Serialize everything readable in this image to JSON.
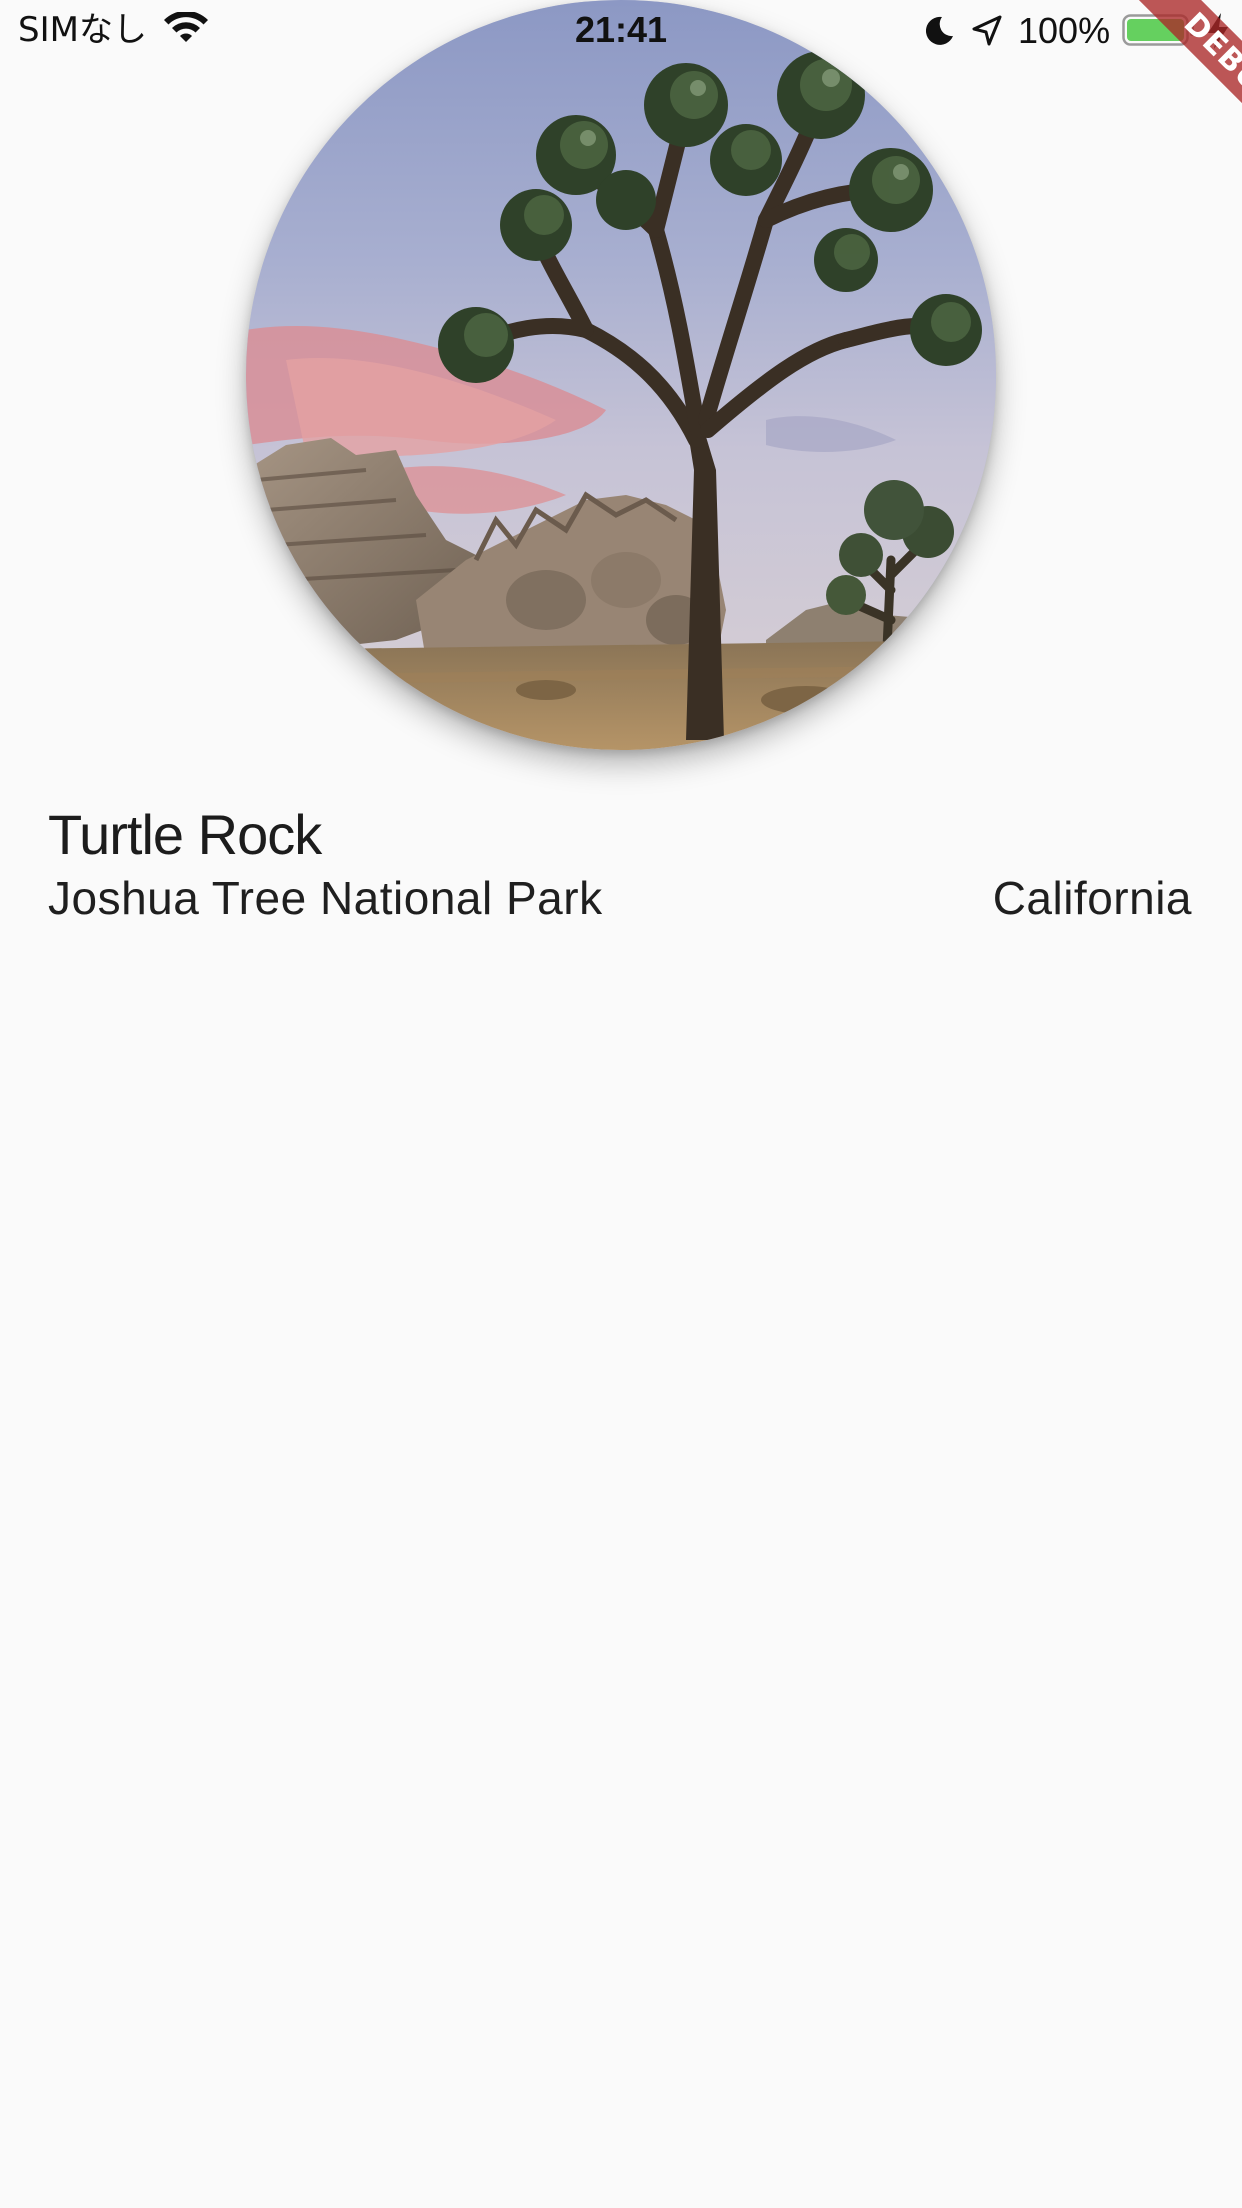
{
  "status_bar": {
    "carrier": "SIMなし",
    "time": "21:41",
    "battery_percent": "100%",
    "battery_level": 1.0,
    "battery_color": "#65d05f",
    "icons": [
      "wifi-icon",
      "moon-icon",
      "location-arrow-icon",
      "battery-icon",
      "charging-bolt-icon"
    ]
  },
  "debug_banner": {
    "label": "DEBUG",
    "color": "#a82828"
  },
  "landmark": {
    "image_subject": "joshua-tree-landscape-photo",
    "name": "Turtle Rock",
    "park": "Joshua Tree National Park",
    "state": "California"
  }
}
